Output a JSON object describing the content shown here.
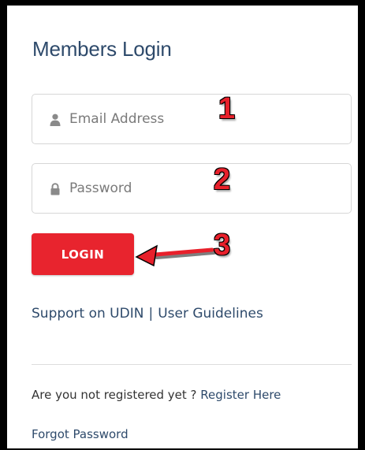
{
  "login_panel": {
    "title": "Members Login",
    "email_field": {
      "placeholder": "Email Address",
      "icon": "user-icon"
    },
    "password_field": {
      "placeholder": "Password",
      "icon": "lock-icon"
    },
    "login_button": {
      "label": "LOGIN",
      "color": "#e8242e"
    },
    "support_link": "Support on UDIN",
    "separator": "|",
    "guidelines_link": "User Guidelines",
    "register_prompt": "Are you not registered yet ?",
    "register_link": "Register Here",
    "forgot_link": "Forgot Password"
  },
  "annotations": {
    "step_1": "1",
    "step_2": "2",
    "step_3": "3",
    "color": "#e8202b"
  },
  "theme": {
    "title_color": "#2e4a6b",
    "frame_color": "#000000"
  }
}
